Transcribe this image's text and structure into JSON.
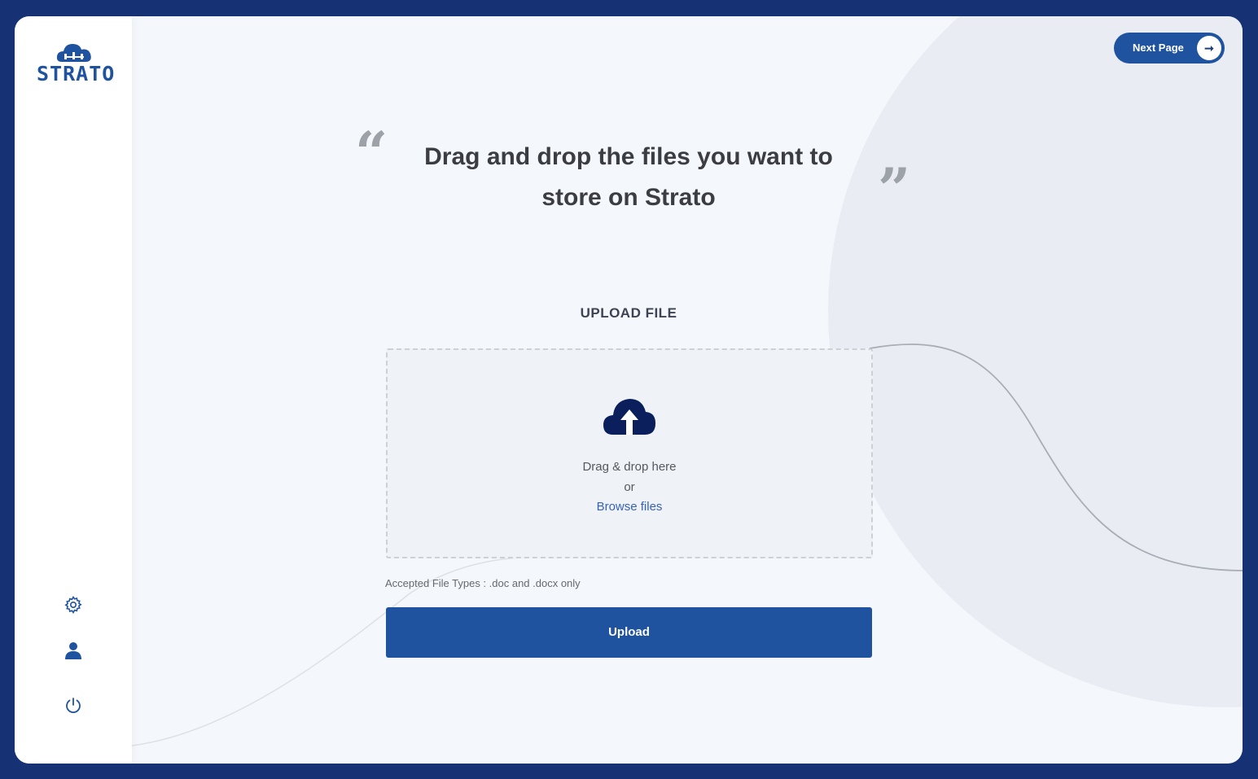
{
  "brand": {
    "name": "STRATO",
    "accent": "#1f53a0",
    "frame_color": "#163275"
  },
  "sidebar": {
    "icons": [
      {
        "name": "gear-icon"
      },
      {
        "name": "user-icon"
      },
      {
        "name": "power-icon"
      }
    ]
  },
  "header": {
    "next_label": "Next Page",
    "next_icon": "arrow-right-icon"
  },
  "hero": {
    "quote_open": "“",
    "quote_close": "”",
    "line1": "Drag and drop the files you want to",
    "line2": "store on Strato"
  },
  "upload": {
    "title": "UPLOAD FILE",
    "drag_text": "Drag & drop here",
    "or_text": "or",
    "browse_text": "Browse files",
    "accepted": "Accepted File Types : .doc and .docx only",
    "button": "Upload",
    "cloud_icon": "cloud-upload-icon",
    "link_color": "#3762b6"
  }
}
